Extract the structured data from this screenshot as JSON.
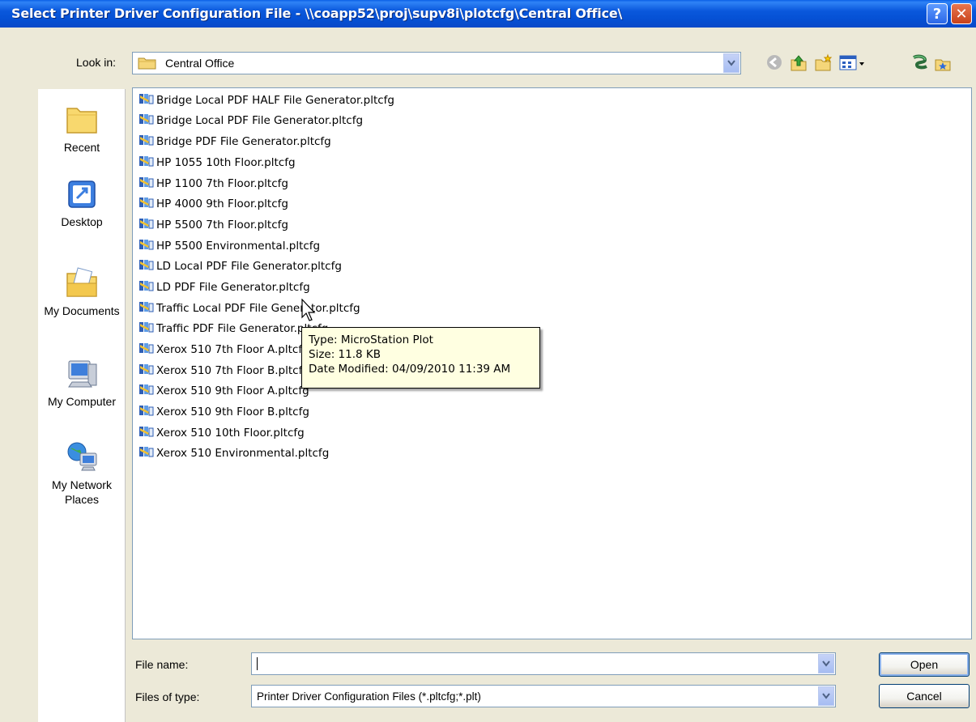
{
  "window": {
    "title": "Select Printer Driver Configuration File - \\\\coapp52\\proj\\supv8i\\plotcfg\\Central Office\\",
    "help_glyph": "?",
    "close_glyph": "✕"
  },
  "lookin": {
    "label": "Look in:",
    "value": "Central Office"
  },
  "toolbar": {
    "icons": [
      "back-icon",
      "up-folder-icon",
      "new-folder-icon",
      "views-menu-icon",
      "link-icon",
      "favorite-icon"
    ]
  },
  "places": [
    {
      "label": "Recent",
      "icon": "recent-folder-icon"
    },
    {
      "label": "Desktop",
      "icon": "desktop-icon"
    },
    {
      "label": "My Documents",
      "icon": "my-documents-icon"
    },
    {
      "label": "My Computer",
      "icon": "my-computer-icon"
    },
    {
      "label": "My Network Places",
      "icon": "network-places-icon"
    }
  ],
  "files": [
    "Bridge Local PDF  HALF File Generator.pltcfg",
    "Bridge Local PDF File Generator.pltcfg",
    "Bridge PDF File Generator.pltcfg",
    "HP 1055 10th Floor.pltcfg",
    "HP 1100 7th Floor.pltcfg",
    "HP 4000 9th Floor.pltcfg",
    "HP 5500 7th Floor.pltcfg",
    "HP 5500 Environmental.pltcfg",
    "LD Local PDF File Generator.pltcfg",
    "LD PDF File Generator.pltcfg",
    "Traffic Local PDF File Generator.pltcfg",
    "Traffic PDF File Generator.pltcfg",
    "Xerox 510 7th Floor A.pltcfg",
    "Xerox 510 7th Floor B.pltcfg",
    "Xerox 510 9th Floor A.pltcfg",
    "Xerox 510 9th Floor B.pltcfg",
    "Xerox 510 10th Floor.pltcfg",
    "Xerox 510 Environmental.pltcfg"
  ],
  "tooltip": {
    "type": "Type: MicroStation Plot",
    "size": "Size: 11.8 KB",
    "modified": "Date Modified: 04/09/2010 11:39 AM"
  },
  "bottom": {
    "filename_label": "File name:",
    "filename_value": "",
    "filetype_label": "Files of type:",
    "filetype_value": "Printer Driver Configuration Files (*.pltcfg;*.plt)",
    "open_label": "Open",
    "cancel_label": "Cancel"
  },
  "colors": {
    "titlebar": "#0a58dc",
    "dialog_bg": "#ece9d8",
    "tooltip_bg": "#ffffe1"
  }
}
